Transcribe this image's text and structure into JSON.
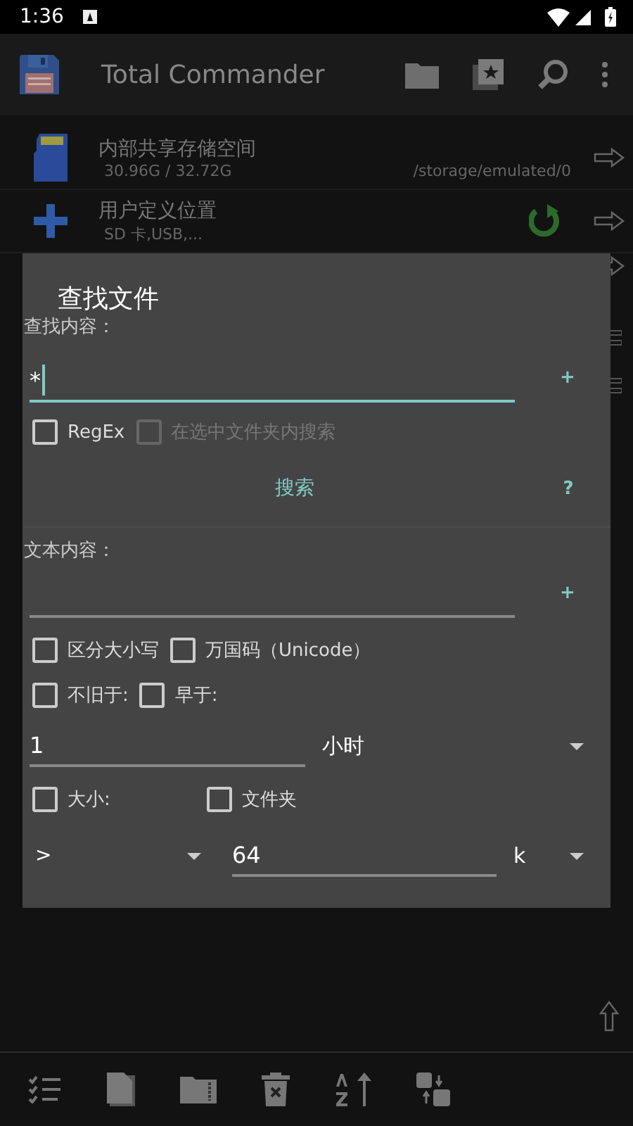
{
  "status_bar": {
    "time": "1:36"
  },
  "app_bar": {
    "title": "Total Commander"
  },
  "storage_list": [
    {
      "kind": "storage",
      "title": "内部共享存储空间",
      "subtitle": "30.96G / 32.72G",
      "path": "/storage/emulated/0"
    },
    {
      "kind": "custom",
      "title": "用户定义位置",
      "subtitle": "SD 卡,USB,..."
    }
  ],
  "dialog": {
    "title": "查找文件",
    "search_label": "查找内容：",
    "search_value": "*",
    "add_symbol": "+",
    "search_options": [
      {
        "label": "RegEx",
        "checked": false,
        "disabled": false
      },
      {
        "label": "在选中文件夹内搜索",
        "checked": false,
        "disabled": true
      }
    ],
    "search_button": "搜索",
    "help": "?",
    "text_label": "文本内容：",
    "text_add_symbol": "+",
    "option_rows": [
      [
        {
          "label": "区分大小写",
          "checked": false
        },
        {
          "label": "万国码（Unicode）",
          "checked": false
        }
      ],
      [
        {
          "label": "不旧于:",
          "checked": false
        },
        {
          "label": "早于:",
          "checked": false
        }
      ]
    ],
    "age_value": "1",
    "age_unit": "小时",
    "size_options": [
      {
        "label": "大小:",
        "checked": false
      },
      {
        "label": "文件夹",
        "checked": false
      }
    ],
    "size_operator": ">",
    "size_value": "64",
    "size_unit": "k"
  }
}
